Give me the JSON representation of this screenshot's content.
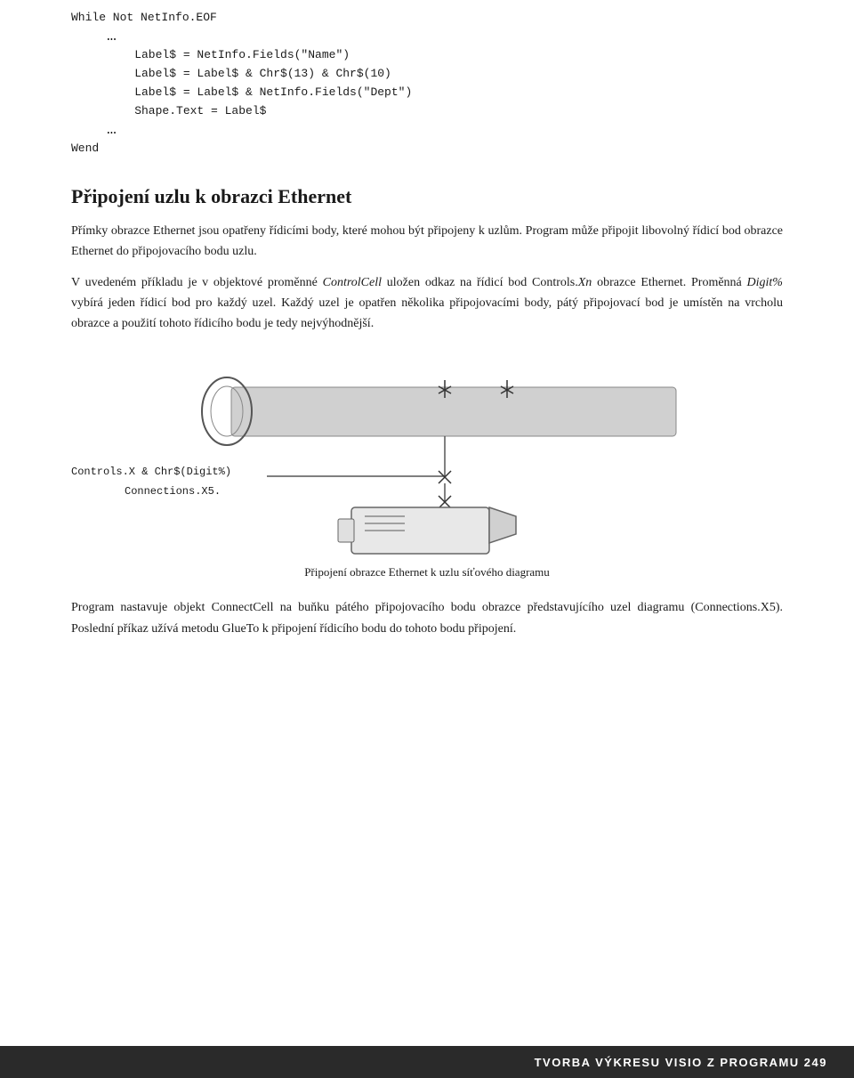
{
  "code": {
    "line1": "While Not NetInfo.EOF",
    "ellipsis1": "…",
    "line2": "    Label$ = NetInfo.Fields(\"Name\")",
    "line3": "    Label$ = Label$ & Chr$(13) & Chr$(10)",
    "line4": "    Label$ = Label$ & NetInfo.Fields(\"Dept\")",
    "line5": "    Shape.Text = Label$",
    "ellipsis2": "…",
    "line6": "Wend"
  },
  "heading": "Připojení uzlu k obrazci Ethernet",
  "paragraph1": "Přímky obrazce Ethernet jsou opatřeny řídicími body, které mohou být připojeny k uzlům. Program může připojit libovolný řídicí bod obrazce Ethernet do připojovacího bodu uzlu.",
  "paragraph2_before": "V uvedeném příkladu je v objektové proměnné ",
  "paragraph2_italic1": "ControlCell",
  "paragraph2_mid1": " uložen odkaz na řídicí bod Controls.",
  "paragraph2_italic2": "Xn",
  "paragraph2_mid2": " obrazce Ethernet. Proměnná ",
  "paragraph2_italic3": "Digit%",
  "paragraph2_end": " vybírá jeden řídicí bod pro každý uzel. Každý uzel je opatřen několika připojovacími body, pátý připojovací bod je umístěn na vrcholu obrazce a použití tohoto řídicího bodu je tedy nejvýhodnější.",
  "labels": {
    "controls": "Controls.X & Chr$(Digit%)",
    "connections": "Connections.X5."
  },
  "caption": "Připojení obrazce Ethernet k uzlu síťového diagramu",
  "paragraph3": "Program nastavuje objekt ConnectCell na buňku pátého připojovacího bodu obrazce představujícího uzel diagramu (Connections.X5). Poslední příkaz užívá metodu GlueTo k připojení řídicího bodu do tohoto bodu připojení.",
  "footer": "TVORBA VÝKRESU VISIO Z PROGRAMU   249"
}
